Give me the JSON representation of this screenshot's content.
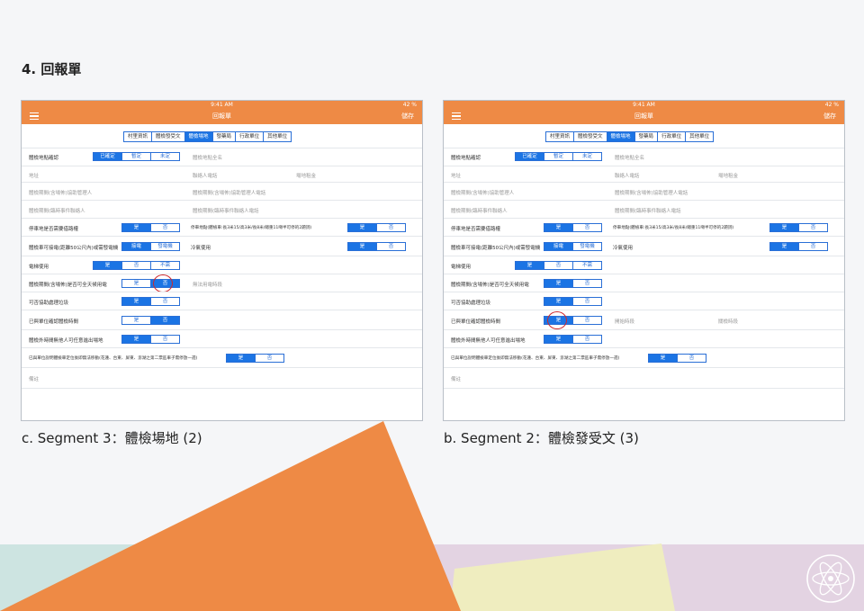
{
  "page_title": "4. 回報單",
  "captions": {
    "left": "c. Segment 3：體檢場地 (2)",
    "right": "b. Segment 2：體檢發受文 (3)"
  },
  "colors": {
    "accent": "#ee8a45",
    "selected": "#1b74e4",
    "highlight_ring": "#d0282c",
    "deco_orange": "#ee8a45",
    "deco_yellow": "#efedbf"
  },
  "status": {
    "time": "9:41 AM",
    "battery": "42 %"
  },
  "nav": {
    "title": "回報單",
    "save": "儲存"
  },
  "tabs": [
    "村里資訊",
    "體檢發受文",
    "體檢場地",
    "發藥局",
    "行政單位",
    "其他單位"
  ],
  "active_tab": "體檢場地",
  "shared_labels": {
    "confirm": "體檢地點確認",
    "confirm_options": [
      "已確定",
      "暫定",
      "未定"
    ],
    "place_name": "體檢地點全名",
    "address": "地址",
    "contact_phone": "聯絡人電話",
    "rent": "場地租金",
    "period_manager": "體檢期間(含場佈)協助管理人",
    "period_manager_phone": "體檢期間(含場佈)協助管理人電話",
    "emergency": "體檢期間(臨時事件聯絡人",
    "emergency_phone": "體檢期間(臨時事件聯絡人電話",
    "parking": "停車地是否需要借路權",
    "bus": "停車地點(體檢車:長3米15/高3米/長8米/總重11噸半可停的2題詞)",
    "power": "體檢車可接電(距離50公尺內)或需發電機",
    "ac": "冷氣使用",
    "elevator": "電梯使用",
    "elevator_options": [
      "是",
      "否",
      "不需"
    ],
    "lounge": "體檢期間(含場佈)是否可全天候用電",
    "no_power": "無法用電時段",
    "trash": "可否協助處理垃圾",
    "record": "已與單位確認體檢時間",
    "outside": "體檢外時間無他人可任意進出場地",
    "notify": "已與單位說明體檢車定位後即無法移動(花蓮、台東、屏東、澎湖之第二票區車子需停放一週)",
    "notes": "備註",
    "start_time": "開始時段",
    "end_time": "關檢時段",
    "yes": "是",
    "no": "否",
    "power_options": [
      "接電",
      "發電機"
    ]
  }
}
